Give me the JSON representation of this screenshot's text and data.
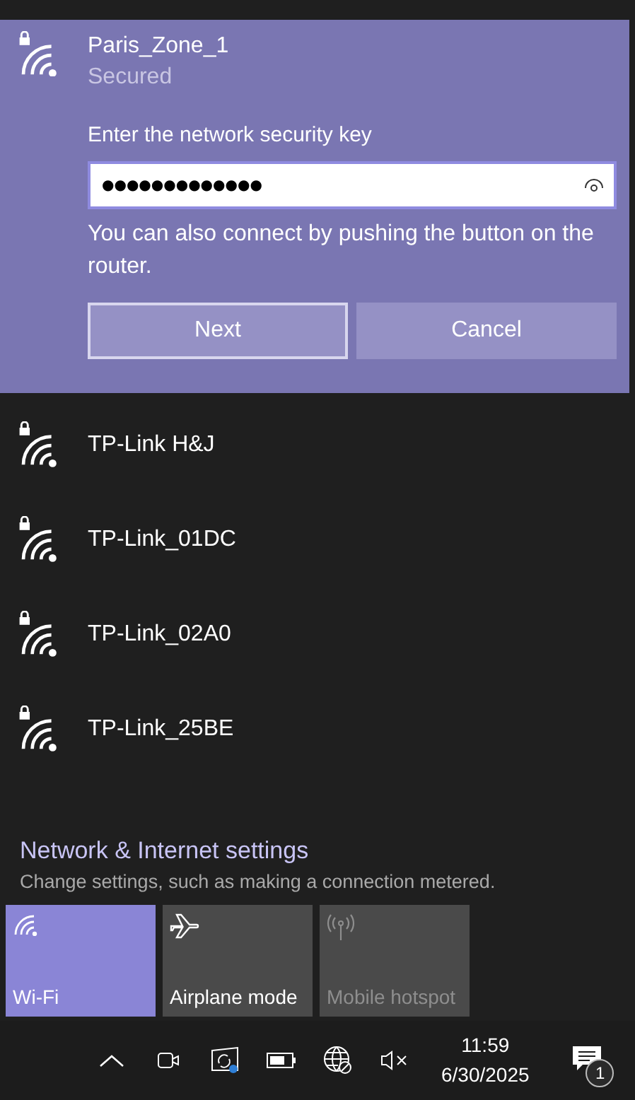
{
  "connecting_network": {
    "name": "Paris_Zone_1",
    "status": "Secured",
    "prompt": "Enter the network security key",
    "key_field": {
      "value": "●●●●●●●●●●●●●"
    },
    "hint": "You can also connect by pushing the button on the router.",
    "buttons": [
      {
        "label": "Next",
        "focused": true
      },
      {
        "label": "Cancel",
        "focused": false
      }
    ]
  },
  "networks": [
    {
      "name": "TP-Link H&J"
    },
    {
      "name": "TP-Link_01DC"
    },
    {
      "name": "TP-Link_02A0"
    },
    {
      "name": "TP-Link_25BE"
    }
  ],
  "settings_link": {
    "title": "Network & Internet settings",
    "description": "Change settings, such as making a connection metered."
  },
  "quick_actions": [
    {
      "kind": "wifi",
      "label": "Wi-Fi",
      "on": true,
      "disabled": false
    },
    {
      "kind": "airplane",
      "label": "Airplane mode",
      "on": false,
      "disabled": false
    },
    {
      "kind": "hotspot",
      "label": "Mobile hotspot",
      "on": false,
      "disabled": true
    }
  ],
  "taskbar": {
    "time": "11:59",
    "date": "6/30/2025",
    "notification_count": "1"
  }
}
